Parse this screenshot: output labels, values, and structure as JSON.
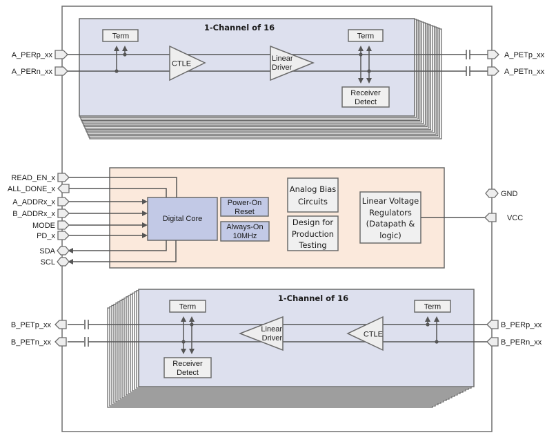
{
  "diagram": {
    "type": "block-diagram",
    "top_channel": {
      "title": "1-Channel of 16",
      "term_left": "Term",
      "ctle": "CTLE",
      "linear_driver": [
        "Linear",
        "Driver"
      ],
      "term_right": "Term",
      "receiver_detect": [
        "Receiver",
        "Detect"
      ],
      "inputs": [
        "A_PERp_xx",
        "A_PERn_xx"
      ],
      "outputs": [
        "A_PETp_xx",
        "A_PETn_xx"
      ]
    },
    "core": {
      "digital_core": "Digital Core",
      "power_on_reset": [
        "Power-On",
        "Reset"
      ],
      "always_on": [
        "Always-On",
        "10MHz"
      ],
      "analog_bias": [
        "Analog Bias",
        "Circuits"
      ],
      "dft": [
        "Design for",
        "Production",
        "Testing"
      ],
      "ldo": [
        "Linear Voltage",
        "Regulators",
        "(Datapath &",
        "logic)"
      ],
      "left_pins": [
        "READ_EN_x",
        "ALL_DONE_x",
        "A_ADDRx_x",
        "B_ADDRx_x",
        "MODE",
        "PD_x",
        "SDA",
        "SCL"
      ],
      "right_pins": [
        "GND",
        "VCC"
      ]
    },
    "bottom_channel": {
      "title": "1-Channel of 16",
      "term_left": "Term",
      "receiver_detect": [
        "Receiver",
        "Detect"
      ],
      "linear_driver": [
        "Linear",
        "Driver"
      ],
      "ctle": "CTLE",
      "term_right": "Term",
      "inputs": [
        "B_PERp_xx",
        "B_PERn_xx"
      ],
      "outputs": [
        "B_PETp_xx",
        "B_PETn_xx"
      ]
    },
    "colors": {
      "channel_fill": "#dde0ee",
      "core_area_fill": "#fbe9dc",
      "digital_block_fill": "#c2c9e6",
      "box_fill": "#f0f0f0",
      "line": "#555555"
    }
  }
}
